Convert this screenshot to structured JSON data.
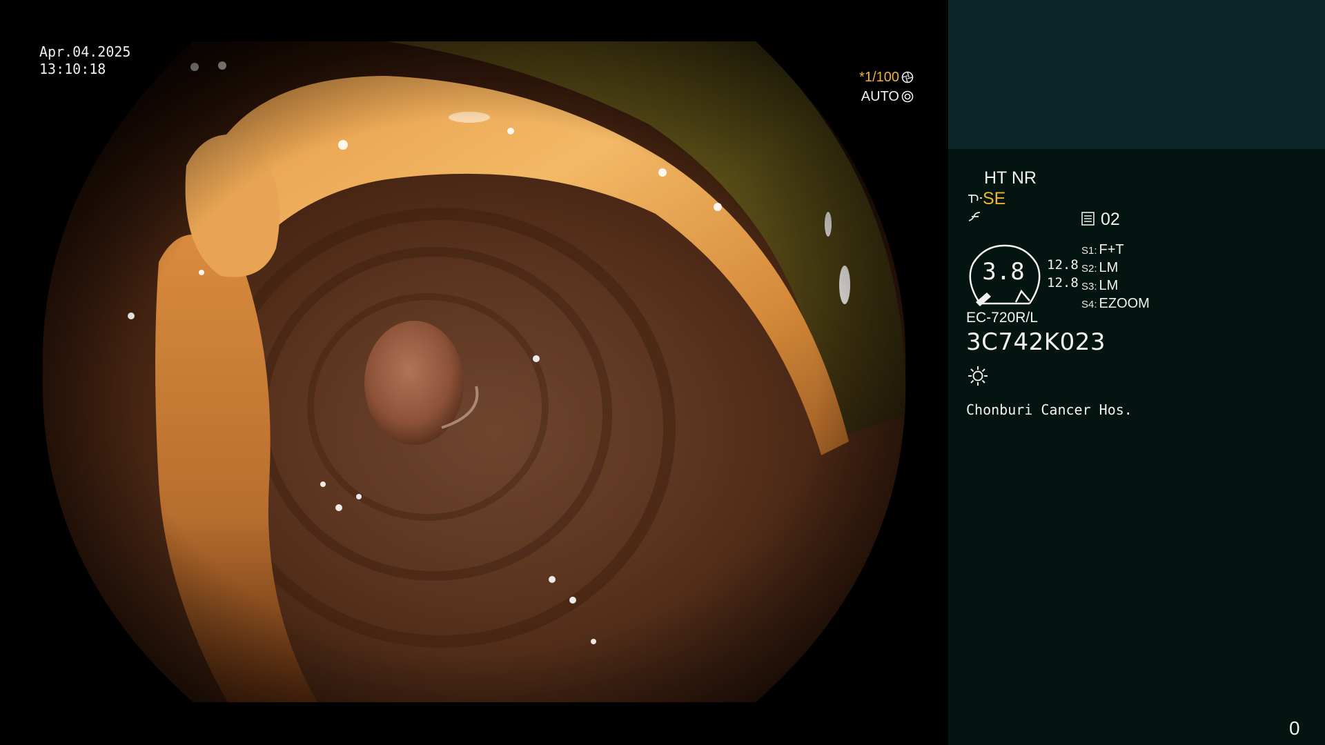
{
  "overlay": {
    "date": "Apr.04.2025",
    "time": "13:10:18",
    "shutter": "*1/100",
    "exposure": "AUTO"
  },
  "panel": {
    "mode": "HT NR",
    "structure_enhancement": "SE",
    "channel": "02",
    "zoom_value": "3.8",
    "values": [
      "12.8",
      "12.8"
    ],
    "switches": [
      {
        "key": "S1:",
        "value": "F+T"
      },
      {
        "key": "S2:",
        "value": "LM"
      },
      {
        "key": "S3:",
        "value": "LM"
      },
      {
        "key": "S4:",
        "value": "EZOOM"
      }
    ],
    "scope_model": "EC-720R/L",
    "scope_serial": "3C742K023",
    "hospital": "Chonburi Cancer Hos.",
    "counter": "0"
  },
  "colors": {
    "accent_amber": "#f2b233",
    "panel_background": "#041410",
    "panel_top": "#0c2628"
  },
  "icons": {
    "shutter": "aperture-icon",
    "exposure": "iris-icon",
    "se": "structure-enhance-icon",
    "enh": "color-enhance-icon",
    "channel": "memory-card-icon",
    "light": "light-icon"
  }
}
